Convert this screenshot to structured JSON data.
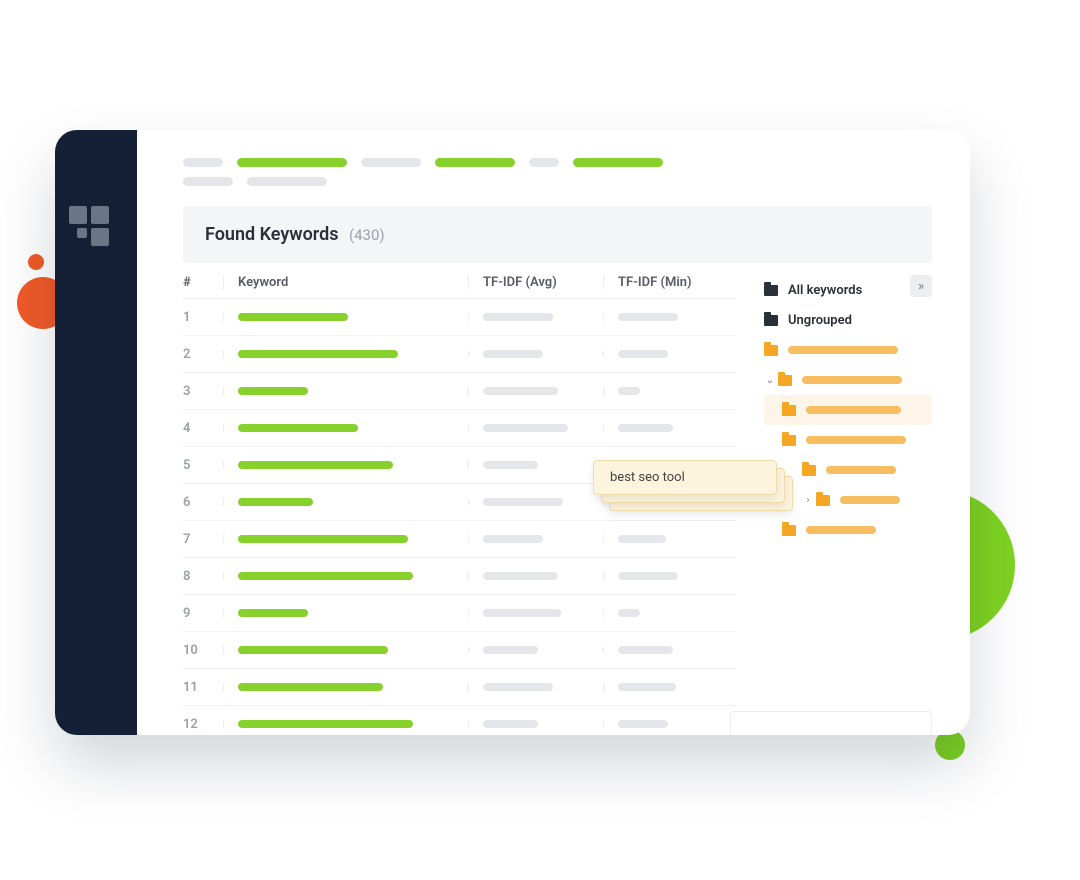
{
  "header": {
    "title": "Found Keywords",
    "count": "(430)"
  },
  "columns": {
    "num": "#",
    "keyword": "Keyword",
    "avg": "TF-IDF (Avg)",
    "min": "TF-IDF (Min)"
  },
  "rows": [
    {
      "n": "1",
      "kw": 110,
      "a": 70,
      "b": 60
    },
    {
      "n": "2",
      "kw": 160,
      "a": 60,
      "b": 50
    },
    {
      "n": "3",
      "kw": 70,
      "a": 75,
      "b": 22
    },
    {
      "n": "4",
      "kw": 120,
      "a": 85,
      "b": 55
    },
    {
      "n": "5",
      "kw": 155,
      "a": 55,
      "b": 42
    },
    {
      "n": "6",
      "kw": 75,
      "a": 80,
      "b": 22
    },
    {
      "n": "7",
      "kw": 170,
      "a": 60,
      "b": 48
    },
    {
      "n": "8",
      "kw": 175,
      "a": 75,
      "b": 60
    },
    {
      "n": "9",
      "kw": 70,
      "a": 78,
      "b": 22
    },
    {
      "n": "10",
      "kw": 150,
      "a": 55,
      "b": 55
    },
    {
      "n": "11",
      "kw": 145,
      "a": 70,
      "b": 58
    },
    {
      "n": "12",
      "kw": 175,
      "a": 55,
      "b": 50
    }
  ],
  "sidepanel": {
    "all": "All keywords",
    "ungrouped": "Ungrouped",
    "collapse": "»"
  },
  "tooltip": "best seo tool"
}
